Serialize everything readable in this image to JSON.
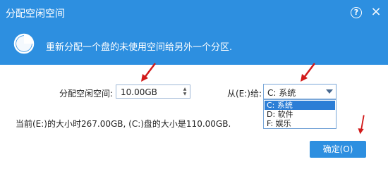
{
  "window": {
    "title": "分配空闲空间",
    "help_icon": "question-circle-icon",
    "close_icon": "close-icon",
    "close_glyph": "×",
    "help_glyph": "?"
  },
  "header": {
    "icon": "pie-chart-icon",
    "subtitle": "重新分配一个盘的未使用空间给另外一个分区."
  },
  "form": {
    "free_space_label": "分配空闲空间:",
    "free_space_value": "10.00GB",
    "target_label": "从(E:)给:",
    "target_selected": "C: 系统",
    "target_options": [
      "C: 系统",
      "D: 软件",
      "F: 娱乐"
    ]
  },
  "info": "当前(E:)的大小时267.00GB, (C:)盘的大小是110.00GB.",
  "ok_button": "确定(O)",
  "colors": {
    "accent": "#2d8fe0",
    "selection": "#2c7ed6",
    "annotation_arrow": "#d11a1a"
  }
}
